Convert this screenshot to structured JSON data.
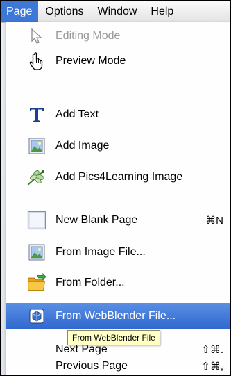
{
  "menubar": {
    "items": [
      {
        "label": "Page",
        "active": true
      },
      {
        "label": "Options",
        "active": false
      },
      {
        "label": "Window",
        "active": false
      },
      {
        "label": "Help",
        "active": false
      }
    ]
  },
  "menu": {
    "editing_mode": {
      "label": "Editing Mode",
      "icon": "arrow-cursor-icon",
      "enabled": false
    },
    "preview_mode": {
      "label": "Preview Mode",
      "icon": "hand-pointer-icon"
    },
    "add_text": {
      "label": "Add Text",
      "icon": "text-T-icon"
    },
    "add_image": {
      "label": "Add Image",
      "icon": "image-icon"
    },
    "add_pics4learning": {
      "label": "Add Pics4Learning Image",
      "icon": "dragonfly-icon"
    },
    "new_blank_page": {
      "label": "New Blank Page",
      "shortcut": "⌘N",
      "icon": "blank-page-icon"
    },
    "from_image_file": {
      "label": "From Image File...",
      "icon": "image-file-icon"
    },
    "from_folder": {
      "label": "From Folder...",
      "icon": "folder-icon"
    },
    "from_webblender_file": {
      "label": "From WebBlender File...",
      "icon": "webblender-icon",
      "highlighted": true
    },
    "next_page": {
      "label": "Next Page",
      "shortcut": "⇧⌘."
    },
    "previous_page": {
      "label": "Previous Page",
      "shortcut": "⇧⌘,"
    }
  },
  "tooltip": {
    "text": "From WebBlender File"
  },
  "colors": {
    "highlight": "#3d77d8",
    "tooltip_bg": "#ffffc6"
  }
}
